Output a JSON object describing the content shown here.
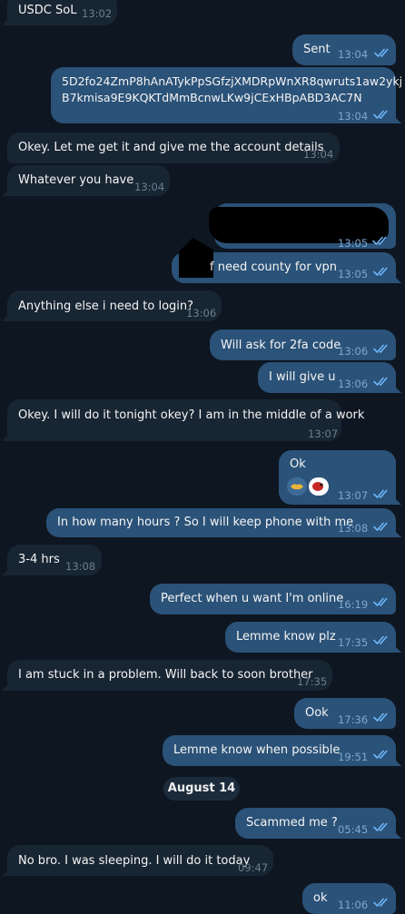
{
  "date_separator": "August 14",
  "messages": [
    {
      "dir": "in",
      "text": "USDC SoL",
      "time": "13:02"
    },
    {
      "dir": "out",
      "text": "Sent",
      "time": "13:04"
    },
    {
      "dir": "out",
      "text_line1": "5D2fo24ZmP8hAnATykPpSGfzjXMDRpWnXR8qwruts1aw2ykj",
      "text_line2": "B7kmisa9E9KQKTdMmBcnwLKw9jCExHBpABD3AC7N",
      "time": "13:04"
    },
    {
      "dir": "in",
      "text": "Okey. Let me get it and give me the account details",
      "time": "13:04"
    },
    {
      "dir": "in",
      "text": "Whatever you have",
      "time": "13:04"
    },
    {
      "dir": "out",
      "text": "",
      "time": "13:05",
      "note": "redacted"
    },
    {
      "dir": "out",
      "text": "f need county for vpn",
      "time": "13:05"
    },
    {
      "dir": "in",
      "text": "Anything else i need to login?",
      "time": "13:06"
    },
    {
      "dir": "out",
      "text": "Will ask for 2fa code",
      "time": "13:06"
    },
    {
      "dir": "out",
      "text": "I will give u",
      "time": "13:06"
    },
    {
      "dir": "in",
      "text": "Okey. I will do it tonight okey? I am in the middle of a work",
      "time": "13:07"
    },
    {
      "dir": "out",
      "text": "Ok",
      "time": "13:07"
    },
    {
      "dir": "out",
      "text": "In how many hours ? So I will keep phone with me",
      "time": "13:08"
    },
    {
      "dir": "in",
      "text": "3-4 hrs",
      "time": "13:08"
    },
    {
      "dir": "out",
      "text": "Perfect when u want I'm online",
      "time": "16:19"
    },
    {
      "dir": "out",
      "text": "Lemme know plz",
      "time": "17:35"
    },
    {
      "dir": "in",
      "text": "I am stuck in a problem. Will back to soon brother",
      "time": "17:35"
    },
    {
      "dir": "out",
      "text": "Ook",
      "time": "17:36"
    },
    {
      "dir": "out",
      "text": "Lemme know when possible",
      "time": "19:51"
    },
    {
      "dir": "out",
      "text": "Scammed me ?",
      "time": "05:45"
    },
    {
      "dir": "in",
      "text": "No bro. I was sleeping. I will do it today",
      "time": "09:47"
    },
    {
      "dir": "out",
      "text": "ok",
      "time": "11:06"
    }
  ],
  "colors": {
    "background": "#0e1621",
    "incoming": "#182533",
    "outgoing": "#2b5278",
    "check": "#6cb5f9"
  },
  "icons": [
    "double-check-icon",
    "handshake-reaction-icon",
    "parrot-reaction-icon"
  ]
}
